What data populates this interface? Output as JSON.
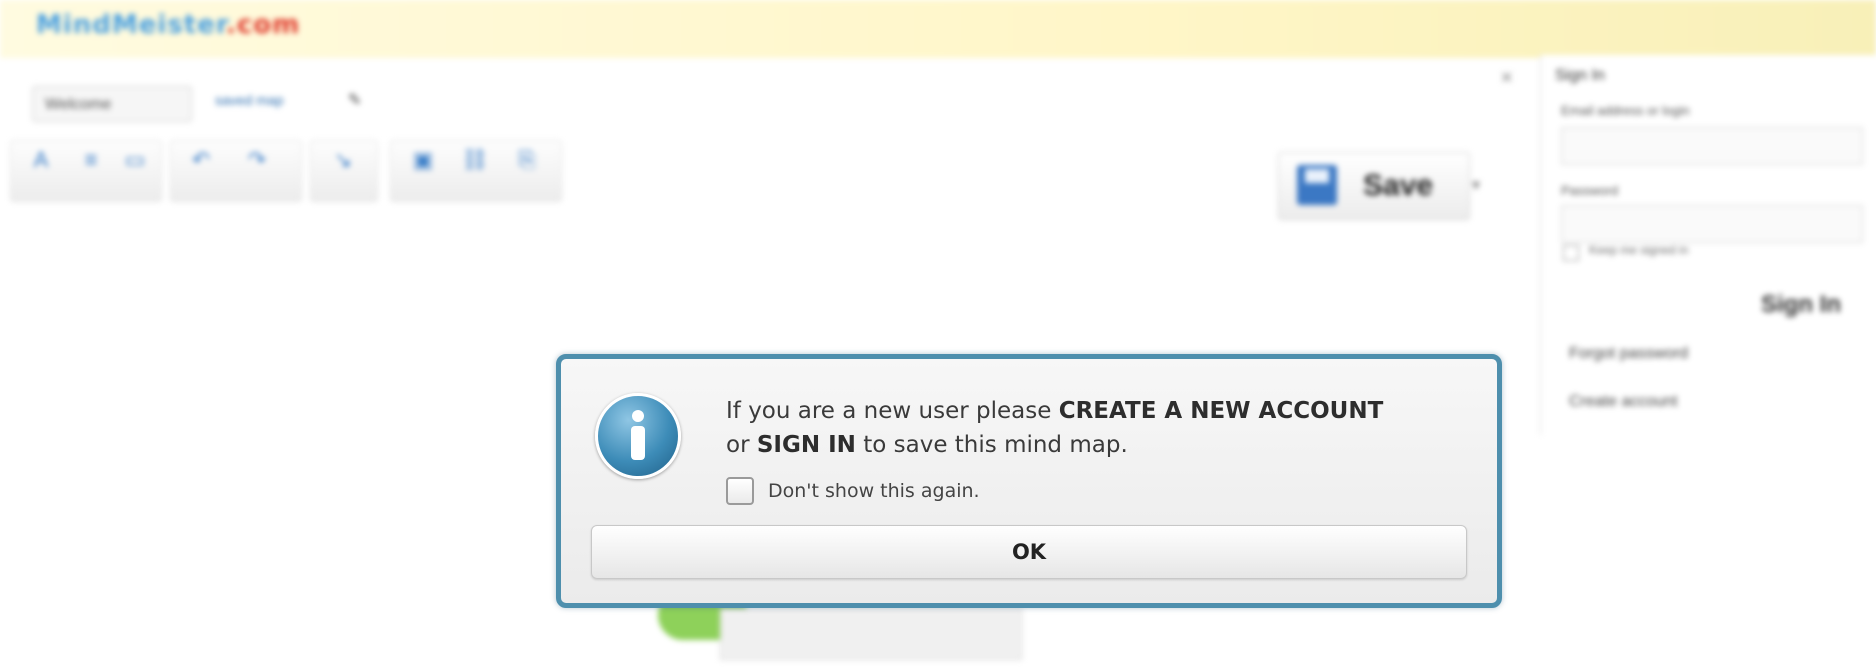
{
  "app": {
    "logo_part1": "MindMeister",
    "logo_part2": ".com"
  },
  "toolbar": {
    "doc_name": "Welcome",
    "doc_meta": "saved map",
    "save_label": "Save"
  },
  "signin": {
    "title": "Sign In",
    "email_label": "Email address or login",
    "password_label": "Password",
    "remember_label": "Keep me signed in",
    "button": "Sign In",
    "forgot_link": "Forgot password",
    "create_link": "Create account"
  },
  "dialog": {
    "line1_prefix": "If you are a new user please ",
    "line1_bold": "CREATE A NEW ACCOUNT",
    "line2_prefix": "or ",
    "line2_bold": "SIGN IN",
    "line2_suffix": " to save this mind map.",
    "dont_show_label": "Don't show this again.",
    "dont_show_checked": false,
    "ok_label": "OK"
  },
  "colors": {
    "dialog_border": "#4e8fad",
    "info_icon": "#3d8cb8"
  }
}
